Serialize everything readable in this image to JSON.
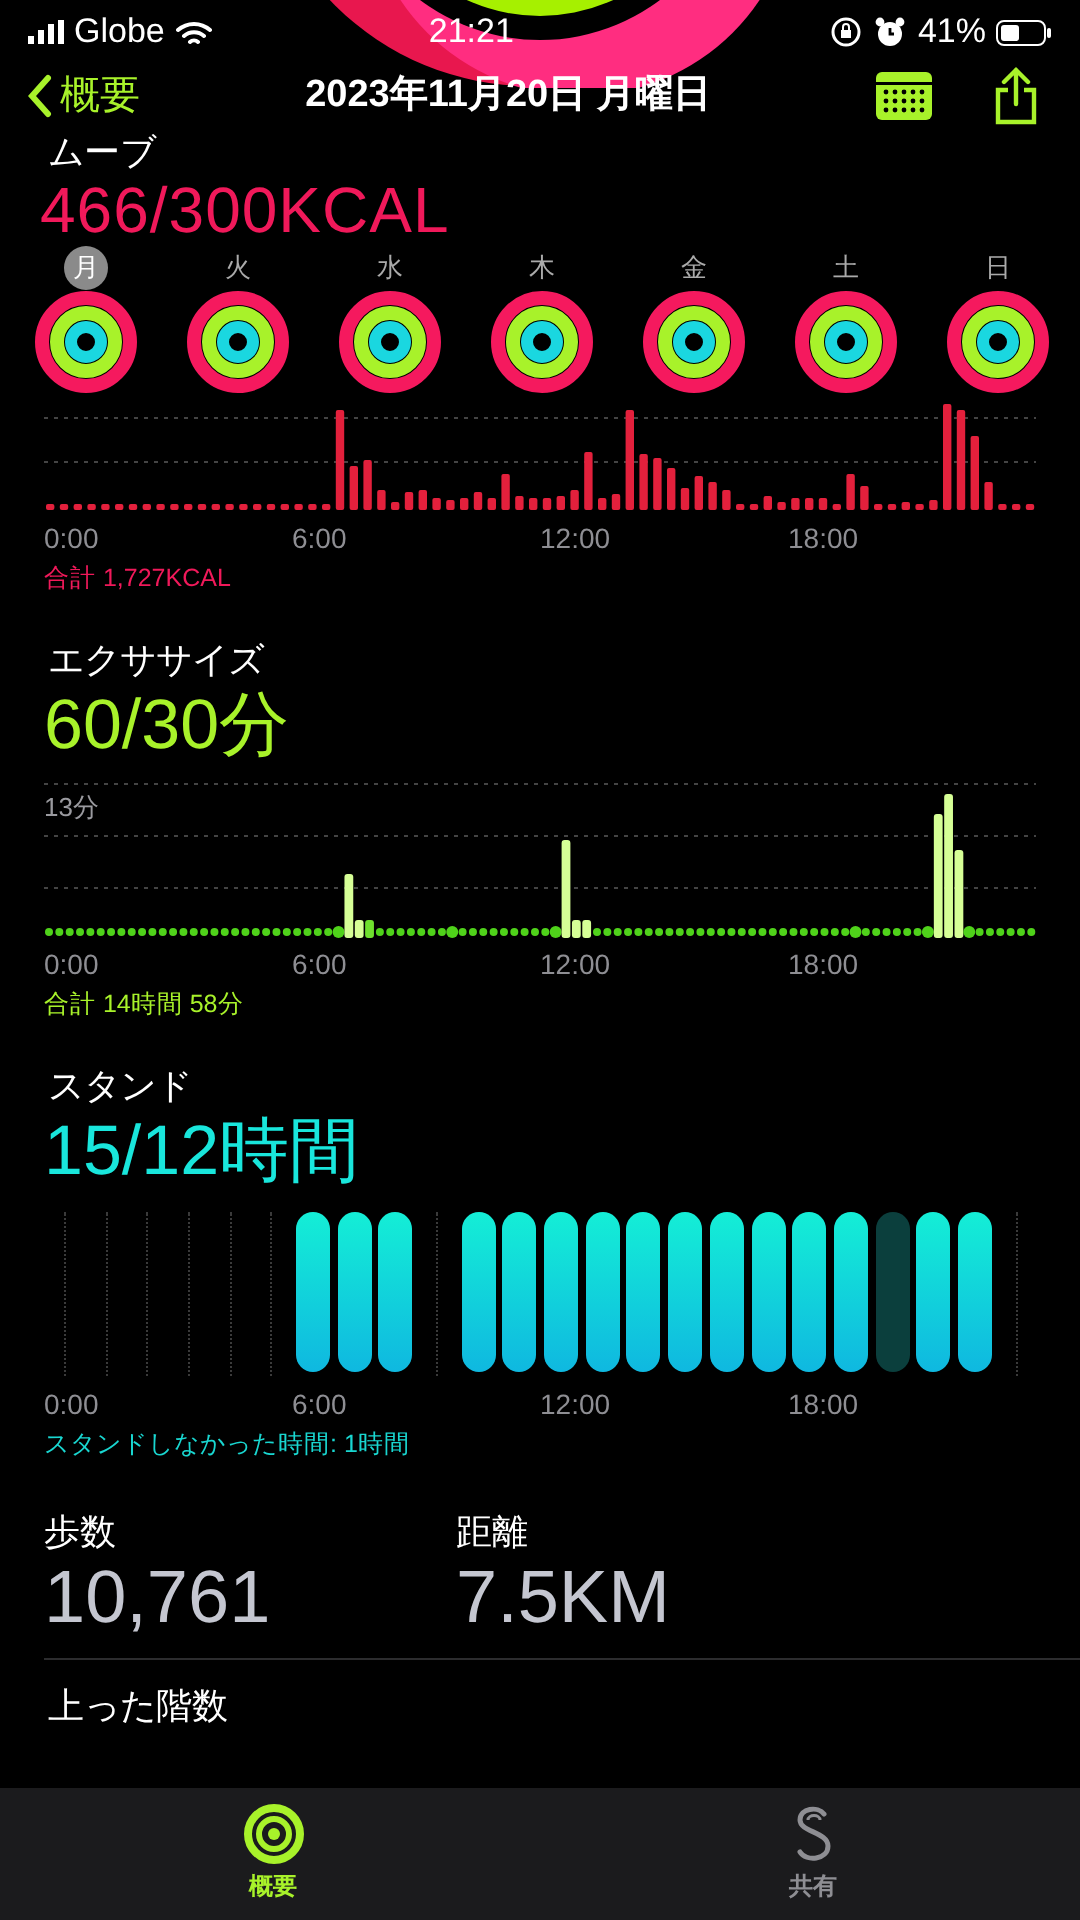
{
  "status_bar": {
    "carrier": "Globe",
    "time": "21:21",
    "battery": "41%"
  },
  "nav": {
    "back": "概要",
    "title": "2023年11月20日 月曜日"
  },
  "move": {
    "title": "ムーブ",
    "value": "466/300KCAL",
    "axis_labels": [
      "0:00",
      "6:00",
      "12:00",
      "18:00"
    ],
    "total": "合計 1,727KCAL"
  },
  "week": [
    {
      "label": "月",
      "selected": true
    },
    {
      "label": "火",
      "selected": false
    },
    {
      "label": "水",
      "selected": false
    },
    {
      "label": "木",
      "selected": false
    },
    {
      "label": "金",
      "selected": false
    },
    {
      "label": "土",
      "selected": false
    },
    {
      "label": "日",
      "selected": false
    }
  ],
  "exercise": {
    "title": "エクササイズ",
    "value": "60/30分",
    "tick": "13分",
    "axis_labels": [
      "0:00",
      "6:00",
      "12:00",
      "18:00"
    ],
    "total": "合計 14時間 58分"
  },
  "stand": {
    "title": "スタンド",
    "value": "15/12時間",
    "hours": [
      {
        "kind": "empty"
      },
      {
        "kind": "empty"
      },
      {
        "kind": "empty"
      },
      {
        "kind": "empty"
      },
      {
        "kind": "empty"
      },
      {
        "kind": "empty"
      },
      {
        "kind": "stood"
      },
      {
        "kind": "stood"
      },
      {
        "kind": "stood"
      },
      {
        "kind": "empty"
      },
      {
        "kind": "stood"
      },
      {
        "kind": "stood"
      },
      {
        "kind": "stood"
      },
      {
        "kind": "stood"
      },
      {
        "kind": "stood"
      },
      {
        "kind": "stood"
      },
      {
        "kind": "stood"
      },
      {
        "kind": "stood"
      },
      {
        "kind": "stood"
      },
      {
        "kind": "stood"
      },
      {
        "kind": "missed"
      },
      {
        "kind": "stood"
      },
      {
        "kind": "stood"
      },
      {
        "kind": "empty"
      }
    ],
    "axis_labels": [
      "0:00",
      "6:00",
      "12:00",
      "18:00"
    ],
    "caption": "スタンドしなかった時間: 1時間"
  },
  "stats": [
    {
      "label": "歩数",
      "value": "10,761"
    },
    {
      "label": "距離",
      "value": "7.5KM"
    }
  ],
  "next_section": "上った階数",
  "tab_bar": [
    {
      "label": "概要",
      "selected": true,
      "kind": "summary"
    },
    {
      "label": "共有",
      "selected": false,
      "kind": "sharing"
    }
  ]
}
